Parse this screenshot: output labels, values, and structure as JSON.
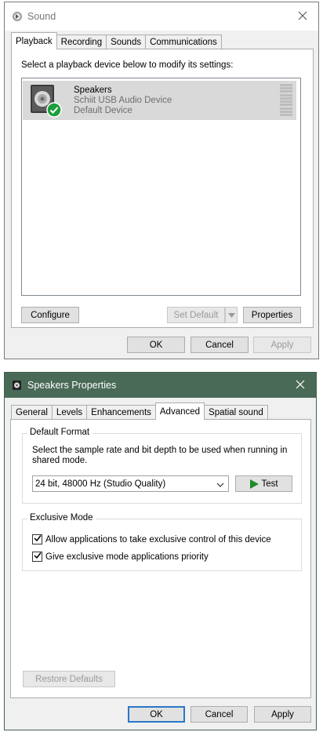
{
  "sound": {
    "title": "Sound",
    "tabs": [
      {
        "label": "Playback",
        "active": true
      },
      {
        "label": "Recording",
        "active": false
      },
      {
        "label": "Sounds",
        "active": false
      },
      {
        "label": "Communications",
        "active": false
      }
    ],
    "instruction": "Select a playback device below to modify its settings:",
    "device": {
      "name": "Speakers",
      "description": "Schiit USB Audio Device",
      "status": "Default Device",
      "icon": "speaker-icon",
      "status_icon": "check-badge-icon"
    },
    "buttons": {
      "configure": "Configure",
      "set_default": "Set Default",
      "properties": "Properties",
      "ok": "OK",
      "cancel": "Cancel",
      "apply": "Apply"
    }
  },
  "properties": {
    "title": "Speakers Properties",
    "tabs": [
      {
        "label": "General",
        "active": false
      },
      {
        "label": "Levels",
        "active": false
      },
      {
        "label": "Enhancements",
        "active": false
      },
      {
        "label": "Advanced",
        "active": true
      },
      {
        "label": "Spatial sound",
        "active": false
      }
    ],
    "default_format": {
      "label": "Default Format",
      "description": "Select the sample rate and bit depth to be used when running in shared mode.",
      "selected": "24 bit, 48000 Hz (Studio Quality)",
      "test_label": "Test"
    },
    "exclusive_mode": {
      "label": "Exclusive Mode",
      "options": [
        {
          "label": "Allow applications to take exclusive control of this device",
          "checked": true
        },
        {
          "label": "Give exclusive mode applications priority",
          "checked": true
        }
      ]
    },
    "buttons": {
      "restore_defaults": "Restore Defaults",
      "ok": "OK",
      "cancel": "Cancel",
      "apply": "Apply"
    }
  },
  "colors": {
    "accent_border": "#2a77c8",
    "props_titlebar": "#4a6a58",
    "check_green": "#1e9e3e",
    "selection": "#d9d9d9"
  }
}
